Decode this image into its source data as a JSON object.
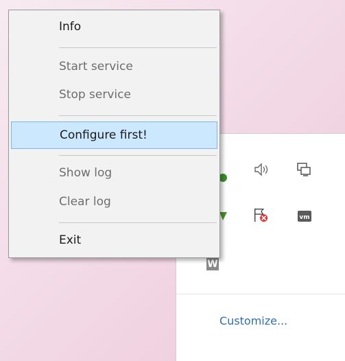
{
  "context_menu": {
    "items": [
      {
        "label": "Info",
        "enabled": true
      },
      {
        "label": "Start service",
        "enabled": false
      },
      {
        "label": "Stop service",
        "enabled": false
      },
      {
        "label": "Configure first!",
        "enabled": true,
        "highlighted": true
      },
      {
        "label": "Show log",
        "enabled": false
      },
      {
        "label": "Clear log",
        "enabled": false
      },
      {
        "label": "Exit",
        "enabled": true
      }
    ]
  },
  "tray": {
    "customize_label": "Customize...",
    "icons": [
      "green-app-icon",
      "speaker-icon",
      "network-icon",
      "green-arrow-icon",
      "action-center-flag-icon",
      "vmware-icon",
      "w-app-icon"
    ],
    "accent_color": "#2f6fb0",
    "highlight_color": "#cce8ff"
  }
}
